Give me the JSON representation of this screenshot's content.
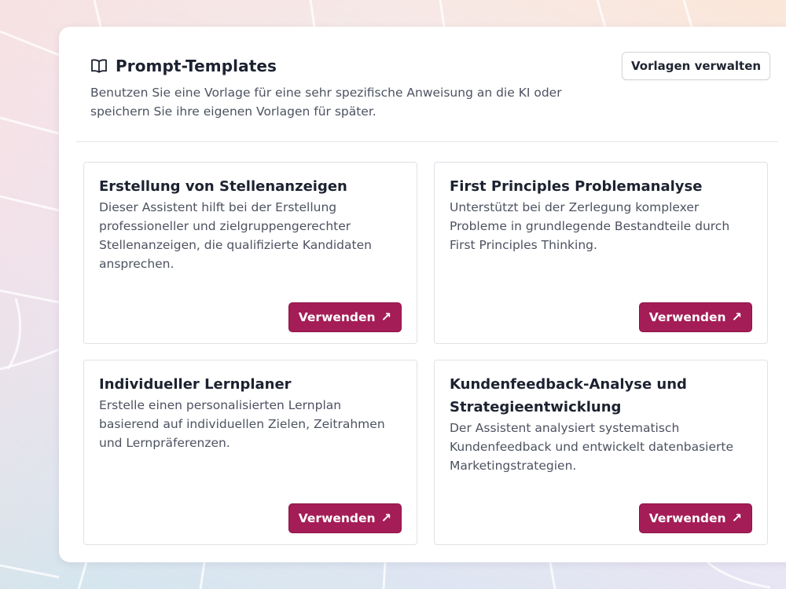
{
  "header": {
    "title": "Prompt-Templates",
    "icon": "book-open-icon",
    "subtitle": "Benutzen Sie eine Vorlage für eine sehr spezifische Anweisung an die KI oder speichern Sie ihre eigenen Vorlagen für später.",
    "manage_label": "Vorlagen verwalten"
  },
  "templates": [
    {
      "title": "Erstellung von Stellenanzeigen",
      "description": "Dieser Assistent hilft bei der Erstellung professioneller und zielgruppengerechter Stellenanzeigen, die qualifizierte Kandidaten ansprechen.",
      "button_label": "Verwenden",
      "button_icon": "arrow-up-right-icon"
    },
    {
      "title": "First Principles Problemanalyse",
      "description": "Unterstützt bei der Zerlegung komplexer Probleme in grundlegende Bestandteile durch First Principles Thinking.",
      "button_label": "Verwenden",
      "button_icon": "arrow-up-right-icon"
    },
    {
      "title": "Individueller Lernplaner",
      "description": "Erstelle einen personalisierten Lernplan basierend auf individuellen Zielen, Zeitrahmen und Lernpräferenzen.",
      "button_label": "Verwenden",
      "button_icon": "arrow-up-right-icon"
    },
    {
      "title": "Kundenfeedback-Analyse und Strategieentwicklung",
      "description": "Der Assistent analysiert systematisch Kundenfeedback und entwickelt datenbasierte Marketingstrategien.",
      "button_label": "Verwenden",
      "button_icon": "arrow-up-right-icon"
    }
  ],
  "colors": {
    "accent": "#a51d56",
    "text": "#1c2230",
    "muted_text": "#4d5260"
  }
}
